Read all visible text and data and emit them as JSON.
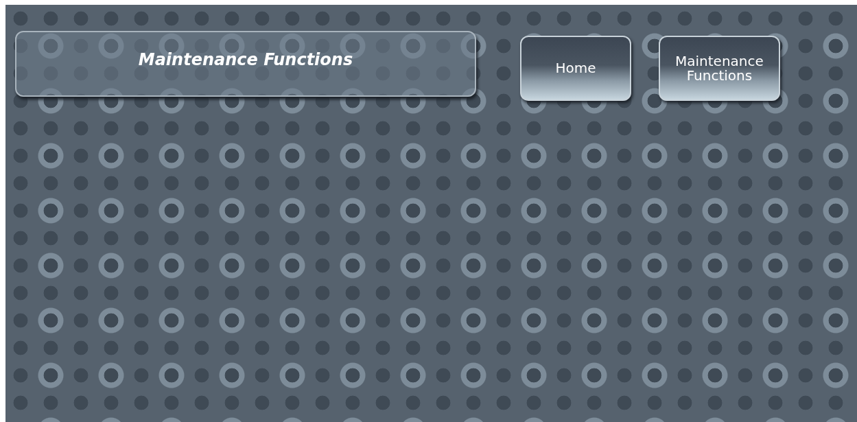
{
  "header": {
    "title": "Maintenance Functions"
  },
  "nav_buttons": [
    {
      "label": "Home"
    },
    {
      "label": "Maintenance\nFunctions"
    }
  ]
}
